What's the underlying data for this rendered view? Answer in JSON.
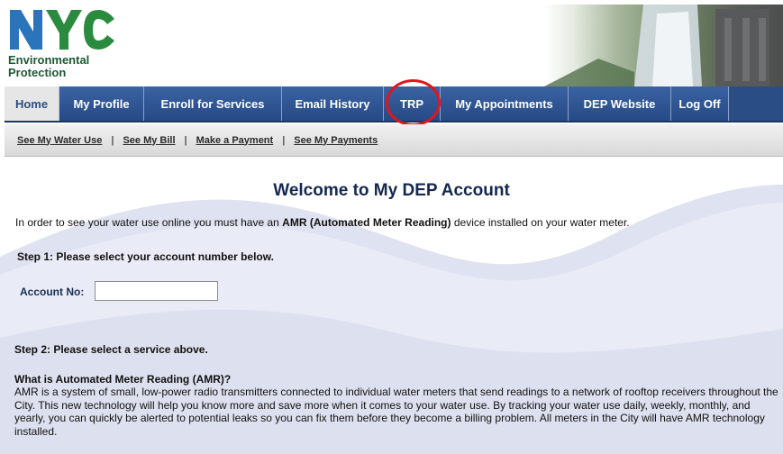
{
  "logo": {
    "wordmark": "NYC",
    "line1": "Environmental",
    "line2": "Protection"
  },
  "nav": {
    "items": [
      {
        "label": "Home",
        "active": true
      },
      {
        "label": "My Profile"
      },
      {
        "label": "Enroll for Services"
      },
      {
        "label": "Email History"
      },
      {
        "label": "TRP"
      },
      {
        "label": "My Appointments"
      },
      {
        "label": "DEP Website"
      },
      {
        "label": "Log Off"
      }
    ]
  },
  "subnav": {
    "items": [
      "See My Water Use",
      "See My Bill",
      "Make a Payment",
      "See My Payments"
    ],
    "separator": "|"
  },
  "main": {
    "title": "Welcome to My DEP Account",
    "intro_pre": "In order to see your water use online you must have an ",
    "intro_bold": "AMR (Automated Meter Reading)",
    "intro_post": " device installed on your water meter.",
    "step1": "Step 1: Please select your account number below.",
    "account_label": "Account No:",
    "account_value": "",
    "step2": "Step 2: Please select a service above.",
    "amr_title": "What is Automated Meter Reading (AMR)?",
    "amr_body": "AMR is a system of small, low-power radio transmitters connected to individual water meters that send readings to a network of rooftop receivers throughout the City. This new technology will help you know more and save more when it comes to your water use. By tracking your water use daily, weekly, monthly, and yearly, you can quickly be alerted to potential leaks so you can fix them before they become a billing problem. All meters in the City will have AMR technology installed."
  },
  "colors": {
    "nav_blue": "#2b4d86",
    "title_navy": "#14284f",
    "annotation_red": "#e3151b",
    "logo_green": "#1c5a33",
    "logo_blue": "#2a74bb",
    "wave": "#dfe3f1"
  }
}
